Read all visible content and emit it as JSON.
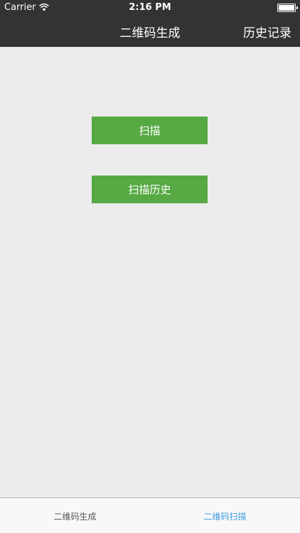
{
  "status_bar": {
    "carrier": "Carrier",
    "time": "2:16 PM",
    "wifi_icon": "wifi-icon",
    "battery_icon": "battery-icon"
  },
  "nav": {
    "title": "二维码生成",
    "right_button": "历史记录"
  },
  "main": {
    "scan_button": "扫描",
    "scan_history_button": "扫描历史",
    "button_color": "#57a944"
  },
  "tabs": [
    {
      "label": "二维码生成",
      "active": false
    },
    {
      "label": "二维码扫描",
      "active": true
    }
  ],
  "colors": {
    "topbar": "#333333",
    "background": "#ececec",
    "tab_active": "#3b9ee0"
  }
}
